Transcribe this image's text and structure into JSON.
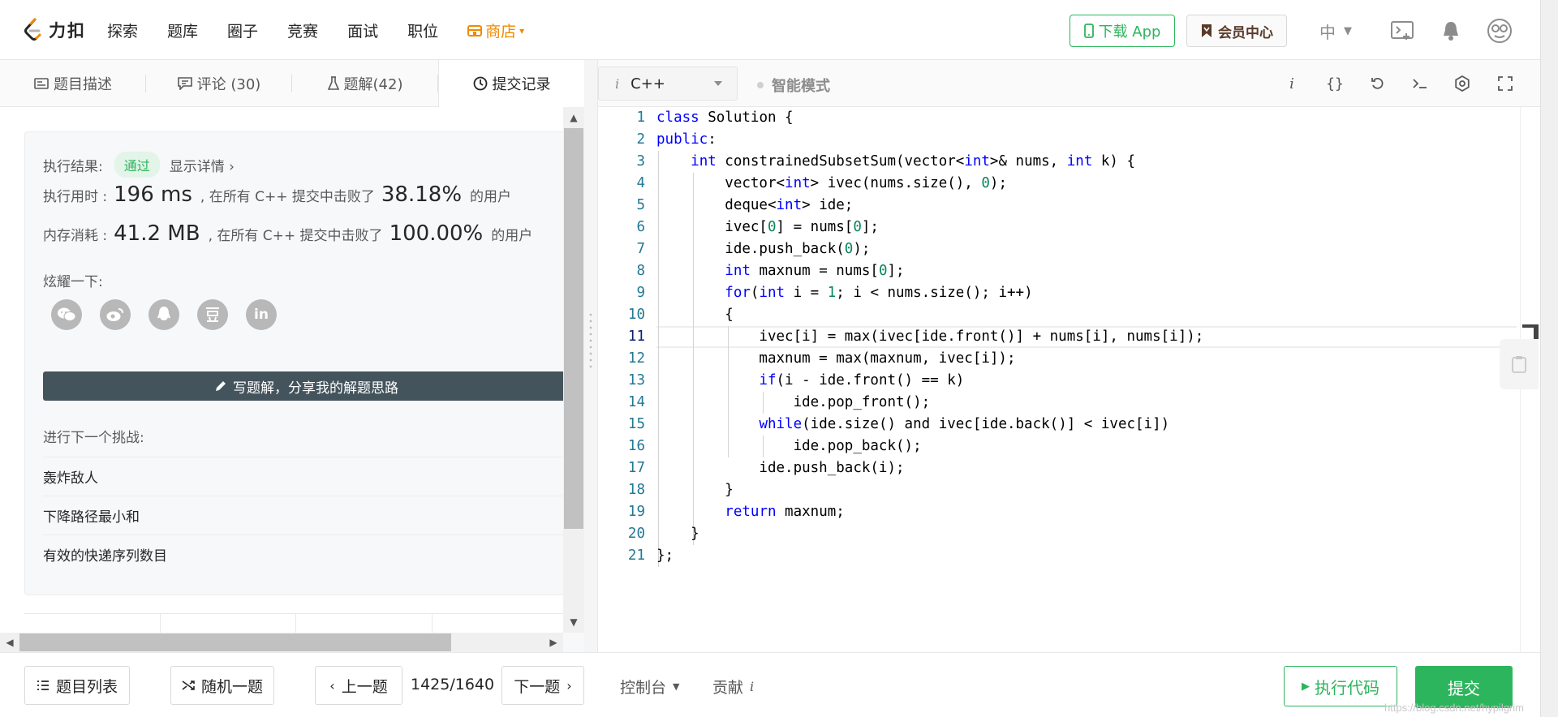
{
  "nav": {
    "logo_text": "力扣",
    "links": [
      "探索",
      "题库",
      "圈子",
      "竞赛",
      "面试",
      "职位"
    ],
    "store_label": "商店",
    "download_app": "下载 App",
    "vip_center": "会员中心",
    "language": "中"
  },
  "tabs": {
    "description": "题目描述",
    "comments": "评论 (30)",
    "solutions": "题解(42)",
    "submissions": "提交记录"
  },
  "result": {
    "label": "执行结果:",
    "status": "通过",
    "details_link": "显示详情 ›",
    "runtime_label": "执行用时 :",
    "runtime_value": "196 ms",
    "runtime_mid": ", 在所有 C++ 提交中击败了",
    "runtime_pct": "38.18%",
    "runtime_suffix": "的用户",
    "memory_label": "内存消耗 :",
    "memory_value": "41.2 MB",
    "memory_mid": ", 在所有 C++ 提交中击败了",
    "memory_pct": "100.00%",
    "memory_suffix": "的用户",
    "share_label": "炫耀一下:",
    "write_solution": "写题解，分享我的解题思路",
    "next_challenge": "进行下一个挑战:",
    "next_items": [
      "轰炸敌人",
      "下降路径最小和",
      "有效的快递序列数目"
    ]
  },
  "editor": {
    "language": "C++",
    "smart_mode": "智能模式",
    "current_line": 11,
    "line_numbers": [
      "1",
      "2",
      "3",
      "4",
      "5",
      "6",
      "7",
      "8",
      "9",
      "10",
      "11",
      "12",
      "13",
      "14",
      "15",
      "16",
      "17",
      "18",
      "19",
      "20",
      "21"
    ]
  },
  "bottom": {
    "problem_list": "题目列表",
    "random": "随机一题",
    "prev": "上一题",
    "page": "1425/1640",
    "next": "下一题",
    "console": "控制台",
    "contribute": "贡献",
    "run": "执行代码",
    "submit": "提交",
    "watermark": "https://blog.csdn.net/hypilgrim"
  },
  "colors": {
    "brand_green": "#2db55d",
    "store_orange": "#f08a00",
    "write_btn": "#44545c",
    "keyword": "#0000ff",
    "number": "#098658"
  }
}
